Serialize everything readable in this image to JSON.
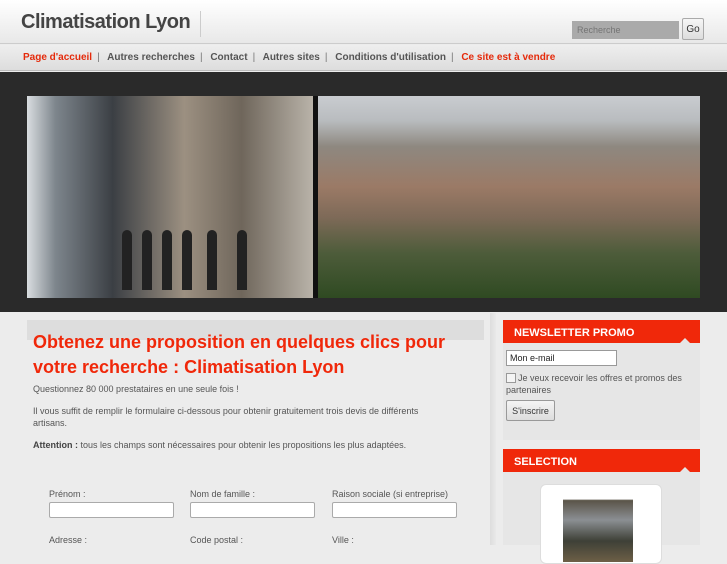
{
  "header": {
    "site_title": "Climatisation Lyon",
    "search_placeholder": "Recherche",
    "search_button": "Go"
  },
  "nav": {
    "items": [
      "Page d'accueil",
      "Autres recherches",
      "Contact",
      "Autres sites",
      "Conditions d'utilisation",
      "Ce site est à vendre"
    ],
    "separator": "|"
  },
  "main": {
    "title": "Obtenez une proposition en quelques clics pour votre recherche : Climatisation Lyon",
    "intro": "Questionnez 80 000 prestataires en une seule fois !",
    "instructions": "Il vous suffit de remplir le formulaire ci-dessous pour obtenir gratuitement trois devis de différents artisans.",
    "attention_label": "Attention :",
    "attention_text": " tous les champs sont nécessaires pour obtenir les propositions les plus adaptées.",
    "form": {
      "prenom": "Prénom :",
      "nom": "Nom de famille :",
      "raison": "Raison sociale (si entreprise)",
      "adresse": "Adresse :",
      "code_postal": "Code postal :",
      "ville": "Ville :"
    }
  },
  "sidebar": {
    "newsletter_title": "NEWSLETTER PROMO",
    "email_value": "Mon e-mail",
    "checkbox_label": "Je veux recevoir les offres et promos des partenaires",
    "subscribe": "S'inscrire",
    "selection_title": "SELECTION"
  },
  "colors": {
    "accent": "#f0280a"
  }
}
